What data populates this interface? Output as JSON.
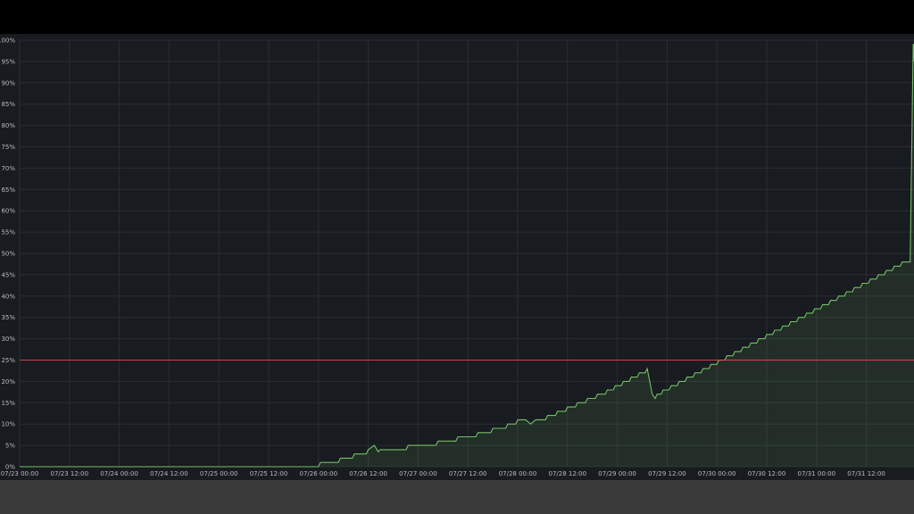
{
  "chart_data": {
    "type": "area",
    "x_tick_labels": [
      "07/23 00:00",
      "07/23 12:00",
      "07/24 00:00",
      "07/24 12:00",
      "07/25 00:00",
      "07/25 12:00",
      "07/26 00:00",
      "07/26 12:00",
      "07/27 00:00",
      "07/27 12:00",
      "07/28 00:00",
      "07/28 12:00",
      "07/29 00:00",
      "07/29 12:00",
      "07/30 00:00",
      "07/30 12:00",
      "07/31 00:00",
      "07/31 12:00"
    ],
    "y_tick_labels": [
      "0%",
      "5%",
      "10%",
      "15%",
      "20%",
      "25%",
      "30%",
      "35%",
      "40%",
      "45%",
      "50%",
      "55%",
      "60%",
      "65%",
      "70%",
      "75%",
      "80%",
      "85%",
      "90%",
      "95%",
      "100%"
    ],
    "xlim_days": [
      0,
      9.045
    ],
    "ylim": [
      0,
      100
    ],
    "threshold": {
      "value": 25,
      "color": "#f2495c"
    },
    "series": [
      {
        "color": "#73bf69",
        "points": [
          [
            0,
            0
          ],
          [
            6.12,
            0
          ],
          [
            6.14,
            1
          ],
          [
            6.32,
            1
          ],
          [
            6.34,
            2
          ],
          [
            6.46,
            2
          ],
          [
            6.48,
            3
          ],
          [
            6.6,
            3
          ],
          [
            6.62,
            4
          ],
          [
            6.68,
            5
          ],
          [
            6.72,
            3.5
          ],
          [
            6.74,
            4
          ],
          [
            7.0,
            4
          ],
          [
            7.02,
            5
          ],
          [
            7.3,
            5
          ],
          [
            7.32,
            6
          ],
          [
            7.5,
            6
          ],
          [
            7.52,
            7
          ],
          [
            7.7,
            7
          ],
          [
            7.72,
            8
          ],
          [
            7.85,
            8
          ],
          [
            7.87,
            9
          ],
          [
            8.0,
            9
          ],
          [
            8.02,
            10
          ],
          [
            8.1,
            10
          ],
          [
            8.12,
            11
          ],
          [
            8.2,
            11
          ],
          [
            8.25,
            10
          ],
          [
            8.3,
            11
          ],
          [
            8.4,
            11
          ],
          [
            8.42,
            12
          ],
          [
            8.5,
            12
          ],
          [
            8.52,
            13
          ],
          [
            8.6,
            13
          ],
          [
            8.62,
            14
          ],
          [
            8.7,
            14
          ],
          [
            8.72,
            15
          ],
          [
            8.8,
            15
          ],
          [
            8.82,
            16
          ],
          [
            8.9,
            16
          ],
          [
            8.92,
            17
          ],
          [
            9.0,
            17
          ],
          [
            9.02,
            18
          ],
          [
            9.08,
            18
          ],
          [
            9.1,
            19
          ],
          [
            9.16,
            19
          ],
          [
            9.18,
            20
          ],
          [
            9.24,
            20
          ],
          [
            9.26,
            21
          ],
          [
            9.32,
            21
          ],
          [
            9.34,
            22
          ],
          [
            9.4,
            22
          ],
          [
            9.42,
            23
          ],
          [
            9.47,
            17
          ],
          [
            9.5,
            16
          ],
          [
            9.52,
            17
          ],
          [
            9.56,
            17
          ],
          [
            9.58,
            18
          ],
          [
            9.64,
            18
          ],
          [
            9.66,
            19
          ],
          [
            9.72,
            19
          ],
          [
            9.74,
            20
          ],
          [
            9.8,
            20
          ],
          [
            9.82,
            21
          ],
          [
            9.88,
            21
          ],
          [
            9.9,
            22
          ],
          [
            9.96,
            22
          ],
          [
            9.98,
            23
          ],
          [
            10.04,
            23
          ],
          [
            10.06,
            24
          ],
          [
            10.12,
            24
          ],
          [
            10.14,
            25
          ],
          [
            10.2,
            25
          ],
          [
            10.22,
            26
          ],
          [
            10.28,
            26
          ],
          [
            10.3,
            27
          ],
          [
            10.36,
            27
          ],
          [
            10.38,
            28
          ],
          [
            10.44,
            28
          ],
          [
            10.46,
            29
          ],
          [
            10.52,
            29
          ],
          [
            10.54,
            30
          ],
          [
            10.6,
            30
          ],
          [
            10.62,
            31
          ],
          [
            10.68,
            31
          ],
          [
            10.7,
            32
          ],
          [
            10.76,
            32
          ],
          [
            10.78,
            33
          ],
          [
            10.84,
            33
          ],
          [
            10.86,
            34
          ],
          [
            10.92,
            34
          ],
          [
            10.94,
            35
          ],
          [
            11.0,
            35
          ],
          [
            11.02,
            36
          ],
          [
            11.08,
            36
          ],
          [
            11.1,
            37
          ],
          [
            11.16,
            37
          ],
          [
            11.18,
            38
          ],
          [
            11.24,
            38
          ],
          [
            11.26,
            39
          ],
          [
            11.32,
            39
          ],
          [
            11.34,
            40
          ],
          [
            11.4,
            40
          ],
          [
            11.42,
            41
          ],
          [
            11.48,
            41
          ],
          [
            11.5,
            42
          ],
          [
            11.56,
            42
          ],
          [
            11.58,
            43
          ],
          [
            11.64,
            43
          ],
          [
            11.66,
            44
          ],
          [
            11.72,
            44
          ],
          [
            11.74,
            45
          ],
          [
            11.8,
            45
          ],
          [
            11.82,
            46
          ],
          [
            11.88,
            46
          ],
          [
            11.9,
            47
          ],
          [
            11.96,
            47
          ],
          [
            11.98,
            48
          ],
          [
            12.06,
            48
          ],
          [
            12.09,
            99
          ],
          [
            12.13,
            99
          ],
          [
            12.16,
            95
          ],
          [
            12.19,
            97
          ],
          [
            12.24,
            96
          ],
          [
            12.26,
            97
          ],
          [
            12.3,
            97
          ],
          [
            12.33,
            96
          ],
          [
            12.36,
            97
          ],
          [
            12.4,
            98
          ],
          [
            12.46,
            98
          ],
          [
            12.5,
            99
          ],
          [
            15.09,
            99
          ]
        ]
      }
    ],
    "grid": true,
    "legend": "none"
  }
}
